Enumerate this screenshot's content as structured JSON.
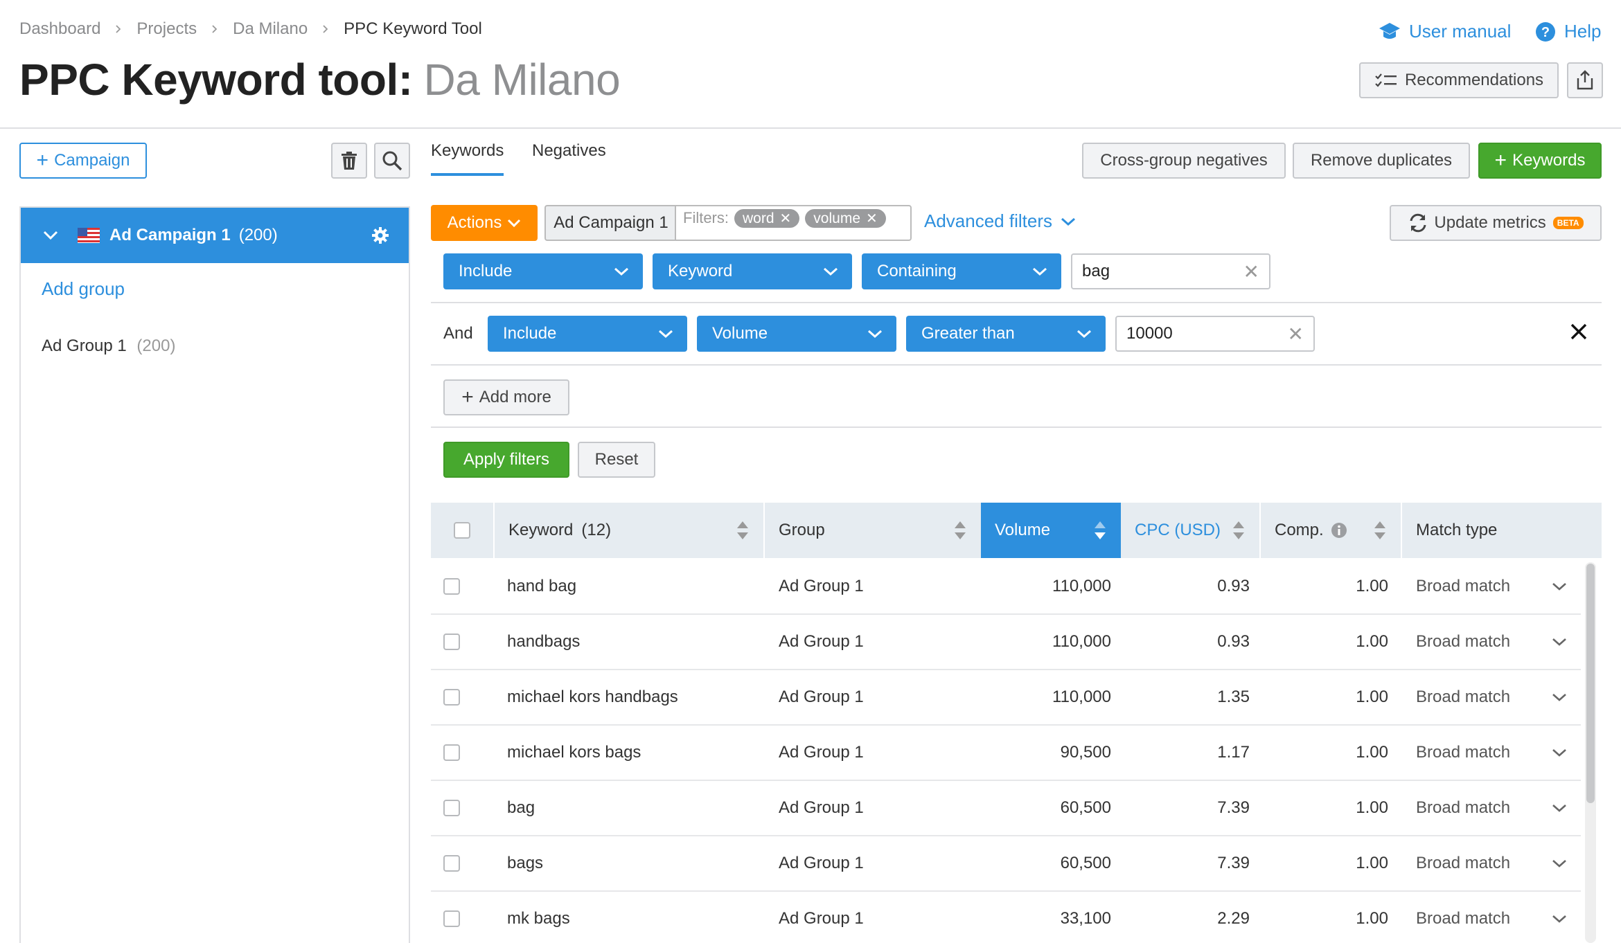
{
  "breadcrumb": [
    "Dashboard",
    "Projects",
    "Da Milano",
    "PPC Keyword Tool"
  ],
  "title": {
    "tool": "PPC Keyword tool:",
    "project": "Da Milano"
  },
  "header_links": {
    "user_manual": "User manual",
    "help": "Help"
  },
  "header_buttons": {
    "recommendations": "Recommendations"
  },
  "left": {
    "campaign_button": "Campaign",
    "campaign": {
      "name": "Ad Campaign 1",
      "count": "(200)"
    },
    "add_group": "Add group",
    "groups": [
      {
        "name": "Ad Group 1",
        "count": "(200)"
      }
    ]
  },
  "tabs": [
    "Keywords",
    "Negatives"
  ],
  "toolbar": {
    "cross_group": "Cross-group negatives",
    "remove_duplicates": "Remove duplicates",
    "add_keywords": "Keywords"
  },
  "filterbar": {
    "actions": "Actions",
    "campaign_chip": "Ad Campaign 1",
    "filters_label": "Filters:",
    "tags": [
      "word",
      "volume"
    ],
    "advanced": "Advanced filters",
    "update_metrics": "Update metrics",
    "beta": "BETA"
  },
  "filters": {
    "row1": {
      "mode": "Include",
      "field": "Keyword",
      "op": "Containing",
      "value": "bag"
    },
    "row2": {
      "conj": "And",
      "mode": "Include",
      "field": "Volume",
      "op": "Greater than",
      "value": "10000"
    },
    "add_more": "Add more",
    "apply": "Apply filters",
    "reset": "Reset"
  },
  "table": {
    "headers": {
      "keyword": "Keyword",
      "keyword_count": "(12)",
      "group": "Group",
      "volume": "Volume",
      "cpc": "CPC (USD)",
      "comp": "Comp.",
      "match": "Match type"
    },
    "rows": [
      {
        "keyword": "hand bag",
        "group": "Ad Group 1",
        "volume": "110,000",
        "cpc": "0.93",
        "comp": "1.00",
        "match": "Broad match"
      },
      {
        "keyword": "handbags",
        "group": "Ad Group 1",
        "volume": "110,000",
        "cpc": "0.93",
        "comp": "1.00",
        "match": "Broad match"
      },
      {
        "keyword": "michael kors handbags",
        "group": "Ad Group 1",
        "volume": "110,000",
        "cpc": "1.35",
        "comp": "1.00",
        "match": "Broad match"
      },
      {
        "keyword": "michael kors bags",
        "group": "Ad Group 1",
        "volume": "90,500",
        "cpc": "1.17",
        "comp": "1.00",
        "match": "Broad match"
      },
      {
        "keyword": "bag",
        "group": "Ad Group 1",
        "volume": "60,500",
        "cpc": "7.39",
        "comp": "1.00",
        "match": "Broad match"
      },
      {
        "keyword": "bags",
        "group": "Ad Group 1",
        "volume": "60,500",
        "cpc": "7.39",
        "comp": "1.00",
        "match": "Broad match"
      },
      {
        "keyword": "mk bags",
        "group": "Ad Group 1",
        "volume": "33,100",
        "cpc": "2.29",
        "comp": "1.00",
        "match": "Broad match"
      }
    ]
  },
  "colors": {
    "accent": "#2d8fdd",
    "actions": "#ff8c00",
    "success": "#47a82e"
  }
}
